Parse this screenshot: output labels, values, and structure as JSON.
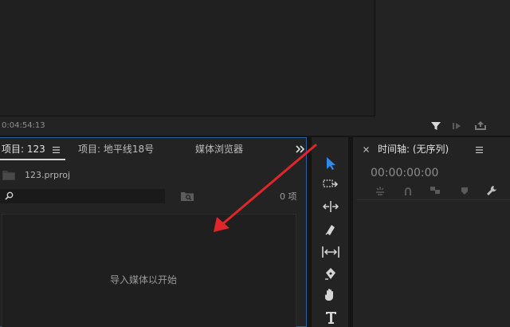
{
  "monitor": {
    "timecode": "0:04:54:13",
    "icons": [
      "filter-icon",
      "insert-icon",
      "export-frame-icon"
    ]
  },
  "project_panel": {
    "tabs": [
      {
        "label": "项目: 123",
        "menu_icon": "hamburger-menu-icon"
      },
      {
        "label": "项目: 地平线18号"
      },
      {
        "label": "媒体浏览器"
      }
    ],
    "overflow_icon": "chevron-double-right-icon",
    "project_file": "123.prproj",
    "search": {
      "placeholder": "",
      "value": ""
    },
    "item_count": "0 项",
    "empty_message": "导入媒体以开始"
  },
  "tools": [
    "selection-tool-icon",
    "track-select-tool-icon",
    "ripple-edit-tool-icon",
    "razor-tool-icon",
    "slip-tool-icon",
    "pen-tool-icon",
    "hand-tool-icon",
    "type-tool-icon"
  ],
  "timeline": {
    "title": "时间轴: (无序列)",
    "timecode": "00:00:00:00",
    "controls": [
      "nest-icon",
      "snap-icon",
      "linked-selection-icon",
      "add-marker-icon",
      "settings-wrench-icon"
    ]
  },
  "colors": {
    "accent": "#2d8ceb",
    "annotation_arrow": "#e0262a",
    "panel_bg": "#232323",
    "app_bg": "#141414"
  }
}
